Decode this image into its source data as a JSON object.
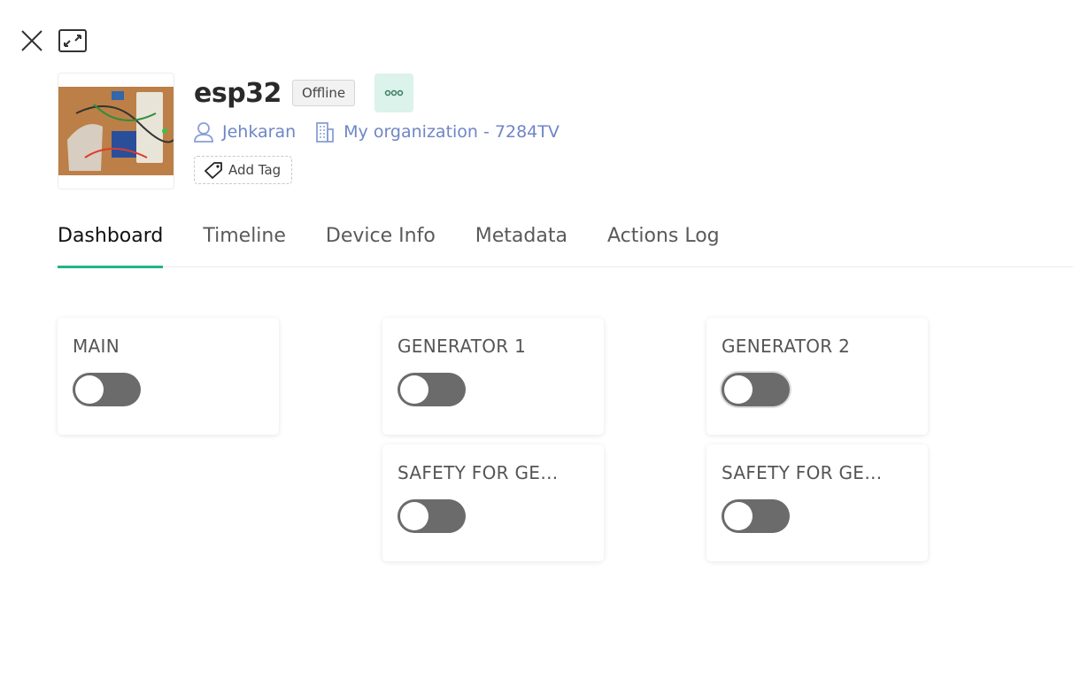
{
  "device": {
    "name": "esp32",
    "status": "Offline",
    "owner": "Jehkaran",
    "organization": "My organization - 7284TV",
    "add_tag_label": "Add Tag"
  },
  "tabs": [
    {
      "label": "Dashboard",
      "active": true
    },
    {
      "label": "Timeline",
      "active": false
    },
    {
      "label": "Device Info",
      "active": false
    },
    {
      "label": "Metadata",
      "active": false
    },
    {
      "label": "Actions Log",
      "active": false
    }
  ],
  "widgets": [
    {
      "title": "MAIN",
      "state": "off"
    },
    {
      "title": "GENERATOR 1",
      "state": "off"
    },
    {
      "title": "GENERATOR 2",
      "state": "off"
    },
    {
      "title": "SAFETY FOR GE…",
      "state": "off"
    },
    {
      "title": "SAFETY FOR GE…",
      "state": "off"
    }
  ],
  "colors": {
    "accent": "#23b28c",
    "link": "#6e86c6",
    "toggle_off": "#6b6b6b",
    "more_button_bg": "#dbf3ea"
  },
  "icons": {
    "close": "close-icon",
    "expand": "expand-icon",
    "more": "more-icon",
    "owner": "user-icon",
    "organization": "building-icon",
    "tag": "tag-icon"
  }
}
